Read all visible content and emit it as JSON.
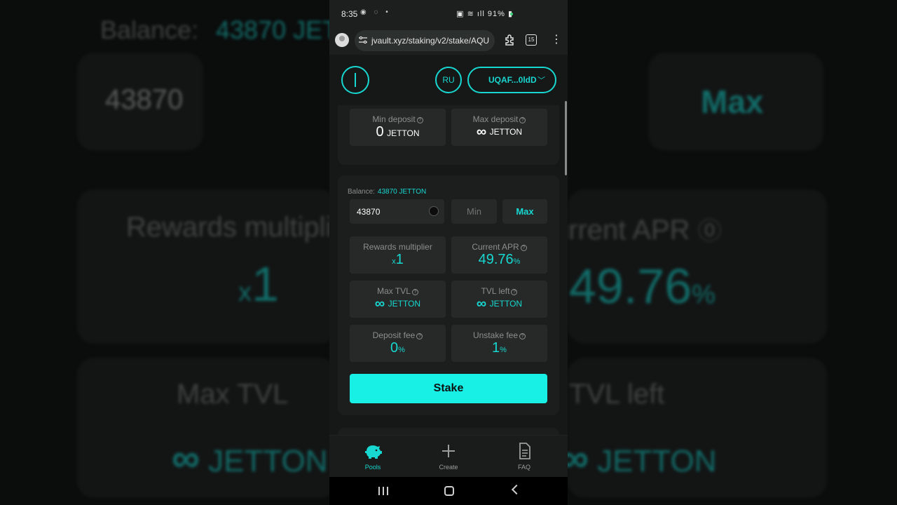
{
  "status": {
    "time": "8:35",
    "battery": "91%"
  },
  "browser": {
    "url": "jvault.xyz/staking/v2/stake/AQU",
    "tab_count": "15"
  },
  "header": {
    "lang": "RU",
    "wallet": "UQAF...0ldD"
  },
  "deposit_limits": {
    "min_label": "Min deposit",
    "min_value": "0",
    "min_unit": "JETTON",
    "max_label": "Max deposit",
    "max_value": "∞",
    "max_unit": "JETTON"
  },
  "stake_form": {
    "balance_label": "Balance:",
    "balance_value": "43870 JETTON",
    "amount": "43870",
    "min_label": "Min",
    "max_label": "Max",
    "stake_label": "Stake"
  },
  "stats": {
    "rewards_label": "Rewards multiplier",
    "rewards_prefix": "x",
    "rewards_value": "1",
    "apr_label": "Current APR",
    "apr_value": "49.76",
    "apr_unit": "%",
    "max_tvl_label": "Max TVL",
    "max_tvl_value": "∞",
    "max_tvl_unit": "JETTON",
    "tvl_left_label": "TVL left",
    "tvl_left_value": "∞",
    "tvl_left_unit": "JETTON",
    "deposit_fee_label": "Deposit fee",
    "deposit_fee_value": "0",
    "deposit_fee_unit": "%",
    "unstake_fee_label": "Unstake fee",
    "unstake_fee_value": "1",
    "unstake_fee_unit": "%"
  },
  "bottom_nav": [
    {
      "label": "Pools",
      "icon": "piggy-bank-icon",
      "active": true
    },
    {
      "label": "Create",
      "icon": "plus-icon",
      "active": false
    },
    {
      "label": "FAQ",
      "icon": "document-icon",
      "active": false
    }
  ],
  "colors": {
    "accent": "#18d7d0",
    "stake_button": "#18f0e6",
    "background": "#161717",
    "tile": "#262928"
  }
}
